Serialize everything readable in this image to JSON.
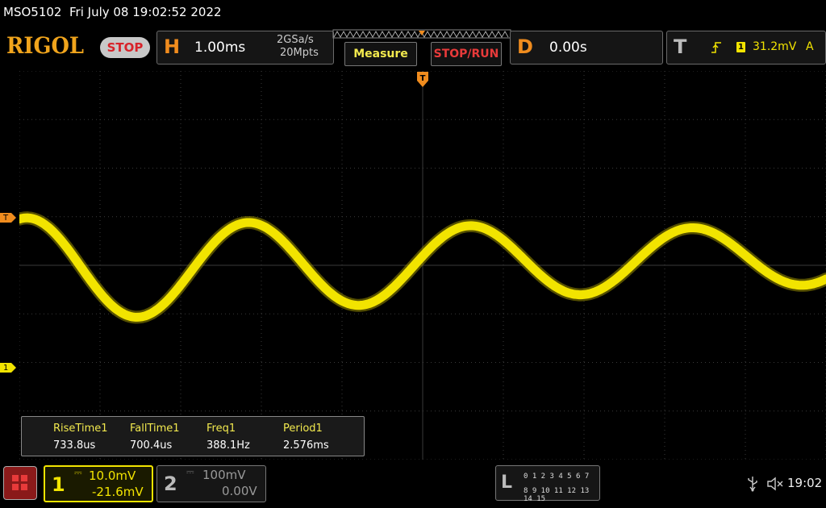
{
  "header": {
    "model": "MSO5102",
    "datetime": "Fri July 08 19:02:52 2022",
    "brand": "RIGOL",
    "status": "STOP"
  },
  "horizontal": {
    "letter": "H",
    "timebase": "1.00ms",
    "sample_rate": "2GSa/s",
    "memory_depth": "20Mpts"
  },
  "buttons": {
    "measure": "Measure",
    "stop_run": "STOP/RUN"
  },
  "delay": {
    "letter": "D",
    "value": "0.00s"
  },
  "trigger": {
    "letter": "T",
    "channel": "1",
    "level": "31.2mV",
    "mode": "A",
    "marker": "T"
  },
  "channel_marker": "1",
  "measurements": [
    {
      "label": "RiseTime1",
      "value": "733.8us"
    },
    {
      "label": "FallTime1",
      "value": "700.4us"
    },
    {
      "label": "Freq1",
      "value": "388.1Hz"
    },
    {
      "label": "Period1",
      "value": "2.576ms"
    }
  ],
  "channels": {
    "ch1": {
      "number": "1",
      "scale": "10.0mV",
      "offset": "-21.6mV"
    },
    "ch2": {
      "number": "2",
      "scale": "100mV",
      "offset": "0.00V"
    }
  },
  "logic": {
    "letter": "L",
    "row1": "0 1 2 3  4 5 6 7",
    "row2": "8 9 10 11 12 13 14 15"
  },
  "system": {
    "clock": "19:02"
  },
  "colors": {
    "ch1": "#f2e400",
    "accent": "#f08c1e",
    "stop": "#d8232a",
    "grid": "#3a3a3a"
  }
}
